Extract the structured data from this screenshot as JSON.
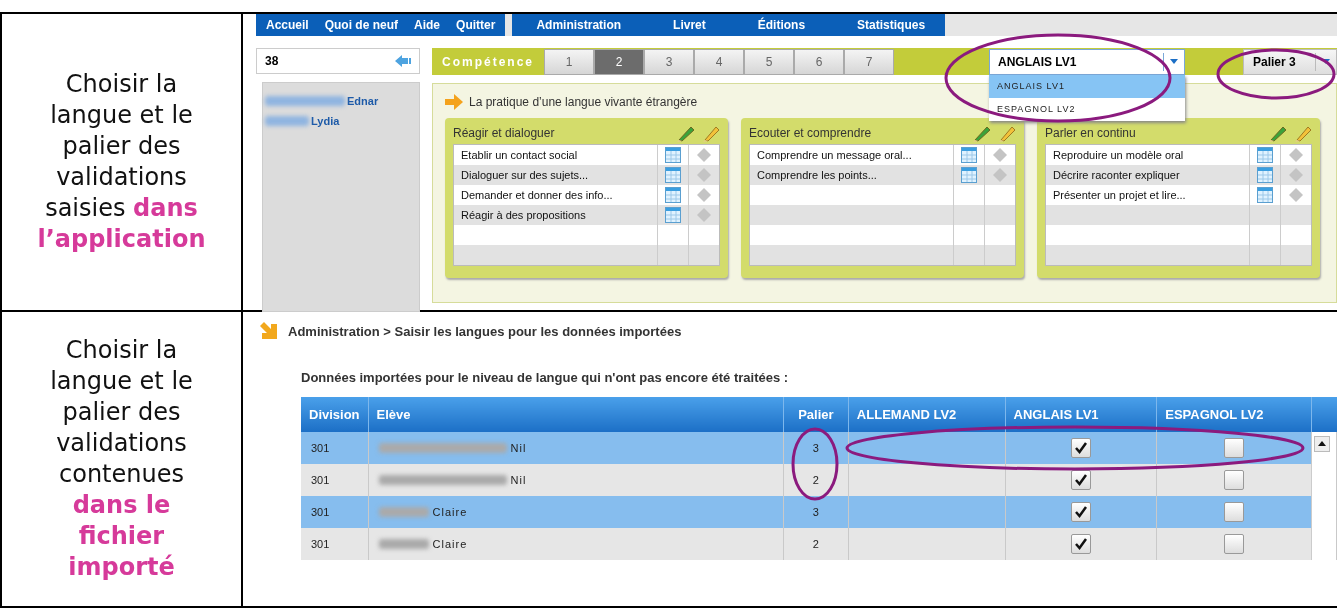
{
  "captions": [
    "Choisir la langue et le palier des validations saisies **dans l’application**",
    "Choisir la langue et le palier des validations contenues **dans le fichier importé**"
  ],
  "app_screen": {
    "nav_left": [
      "Accueil",
      "Quoi de neuf",
      "Aide",
      "Quitter"
    ],
    "nav_right": [
      "Administration",
      "Livret",
      "Éditions",
      "Statistiques"
    ],
    "search": {
      "value": "38"
    },
    "students": [
      {
        "name": "Ednar"
      },
      {
        "name": "Lydia"
      }
    ],
    "competence_label": "Compétence",
    "tabs": [
      {
        "label": "1",
        "selected": false
      },
      {
        "label": "2",
        "selected": true
      },
      {
        "label": "3",
        "selected": false
      },
      {
        "label": "4",
        "selected": false
      },
      {
        "label": "5",
        "selected": false
      },
      {
        "label": "6",
        "selected": false
      },
      {
        "label": "7",
        "selected": false
      }
    ],
    "language_select": {
      "value": "ANGLAIS LV1",
      "expanded": true,
      "options": [
        {
          "label": "ANGLAIS LV1",
          "selected": true
        },
        {
          "label": "ESPAGNOL LV2",
          "selected": false
        }
      ]
    },
    "palier_select": {
      "value": "Palier 3"
    },
    "domain": "La pratique d’une langue vivante étrangère",
    "panels": [
      {
        "title": "Réagir et dialoguer",
        "items": [
          "Etablir un contact social",
          "Dialoguer sur des sujets...",
          "Demander et donner des info...",
          "Réagir à des propositions"
        ]
      },
      {
        "title": "Ecouter et comprendre",
        "items": [
          "Comprendre un message oral...",
          "Comprendre les points..."
        ]
      },
      {
        "title": "Parler en continu",
        "items": [
          "Reproduire un modèle oral",
          "Décrire raconter expliquer",
          "Présenter un projet et lire..."
        ]
      }
    ]
  },
  "import_screen": {
    "breadcrumb": "Administration > Saisir les langues pour les données importées",
    "heading": "Données importées pour le niveau de langue qui n'ont pas encore été traitées :",
    "columns": [
      "Division",
      "Elève",
      "Palier",
      "ALLEMAND LV2",
      "ANGLAIS LV1",
      "ESPAGNOL LV2"
    ],
    "rows": [
      {
        "division": "301",
        "student": "Nil",
        "palier": "3",
        "anglais_lv1_checked": true,
        "espagnol_lv2_checked": false
      },
      {
        "division": "301",
        "student": "Nil",
        "palier": "2",
        "anglais_lv1_checked": true,
        "espagnol_lv2_checked": false
      },
      {
        "division": "301",
        "student": "Claire",
        "palier": "3",
        "anglais_lv1_checked": true,
        "espagnol_lv2_checked": false
      },
      {
        "division": "301",
        "student": "Claire",
        "palier": "2",
        "anglais_lv1_checked": true,
        "espagnol_lv2_checked": false
      }
    ]
  }
}
